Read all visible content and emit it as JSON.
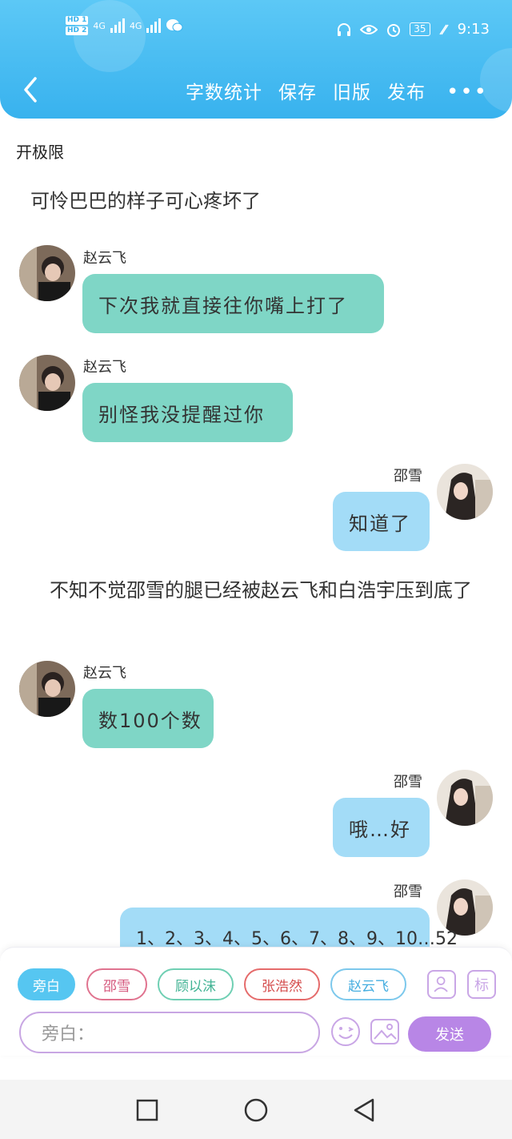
{
  "status_bar": {
    "hd1": "HD 1",
    "hd2": "HD 2",
    "net1": "4G",
    "net2": "4G",
    "battery": "35",
    "time": "9:13"
  },
  "toolbar": {
    "word_count": "字数统计",
    "save": "保存",
    "old_version": "旧版",
    "publish": "发布",
    "more": "•••"
  },
  "document": {
    "title": "开极限"
  },
  "story": {
    "narration_1": "可怜巴巴的样子可心疼坏了",
    "msg_1": {
      "name": "赵云飞",
      "text": "下次我就直接往你嘴上打了"
    },
    "msg_2": {
      "name": "赵云飞",
      "text": "别怪我没提醒过你"
    },
    "msg_3": {
      "name": "邵雪",
      "text": "知道了"
    },
    "narration_2": "　不知不觉邵雪的腿已经被赵云飞和白浩宇压到底了",
    "msg_4": {
      "name": "赵云飞",
      "text": "数100个数"
    },
    "msg_5": {
      "name": "邵雪",
      "text": "哦…好"
    },
    "msg_6": {
      "name": "邵雪",
      "text": "1、2、3、4、5、6、7、8、9、10…52"
    }
  },
  "roles": {
    "narrator": "旁白",
    "role_1": "邵雪",
    "role_2": "顾以沫",
    "role_3": "张浩然",
    "role_4": "赵云飞",
    "mark": "标"
  },
  "composer": {
    "placeholder": "旁白：",
    "send": "发送"
  },
  "colors": {
    "header": "#38b2ee",
    "green_bubble": "#7fd6c6",
    "blue_bubble": "#a3dcf7",
    "send": "#b886e6"
  }
}
